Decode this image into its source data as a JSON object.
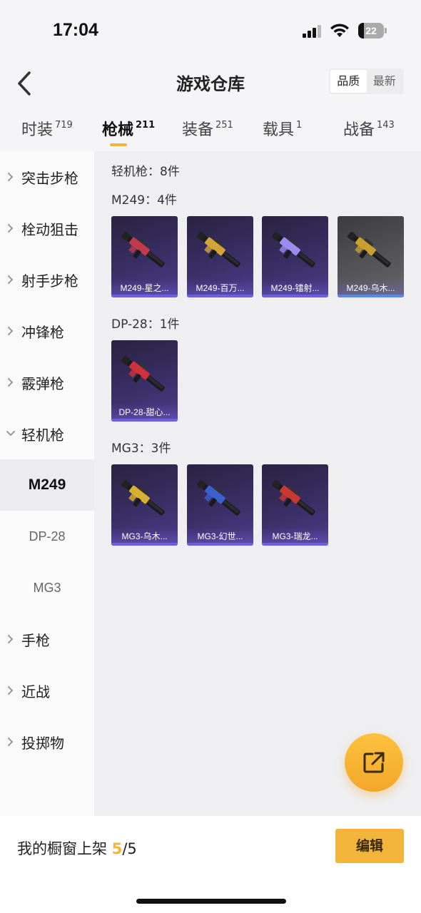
{
  "status": {
    "time": "17:04",
    "battery": "22"
  },
  "nav": {
    "title": "游戏仓库",
    "sort_options": [
      "品质",
      "最新"
    ],
    "sort_active": 0
  },
  "tabs": [
    {
      "label": "时装",
      "count": "719"
    },
    {
      "label": "枪械",
      "count": "211"
    },
    {
      "label": "装备",
      "count": "251"
    },
    {
      "label": "载具",
      "count": "1"
    },
    {
      "label": "战备",
      "count": "143"
    }
  ],
  "tab_active": 1,
  "sidebar": {
    "categories": [
      {
        "label": "突击步枪",
        "expanded": false
      },
      {
        "label": "栓动狙击",
        "expanded": false
      },
      {
        "label": "射手步枪",
        "expanded": false
      },
      {
        "label": "冲锋枪",
        "expanded": false
      },
      {
        "label": "霰弹枪",
        "expanded": false
      },
      {
        "label": "轻机枪",
        "expanded": true
      },
      {
        "label": "手枪",
        "expanded": false
      },
      {
        "label": "近战",
        "expanded": false
      },
      {
        "label": "投掷物",
        "expanded": false
      }
    ],
    "subitems": [
      {
        "label": "M249",
        "active": true
      },
      {
        "label": "DP-28",
        "active": false
      },
      {
        "label": "MG3",
        "active": false
      }
    ]
  },
  "content": {
    "summary": "轻机枪：8件",
    "groups": [
      {
        "title": "M249：4件",
        "items": [
          {
            "name": "M249-星之...",
            "style": "purple",
            "accent": "#c03a4a"
          },
          {
            "name": "M249-百万...",
            "style": "purple",
            "accent": "#d4a43a"
          },
          {
            "name": "M249-镭射...",
            "style": "purple",
            "accent": "#9a8cf0"
          },
          {
            "name": "M249-乌木...",
            "style": "gray",
            "accent": "#c8a030"
          }
        ]
      },
      {
        "title": "DP-28：1件",
        "items": [
          {
            "name": "DP-28-甜心...",
            "style": "purple",
            "accent": "#d0303c"
          }
        ]
      },
      {
        "title": "MG3：3件",
        "items": [
          {
            "name": "MG3-乌木...",
            "style": "purple",
            "accent": "#d8b030"
          },
          {
            "name": "MG3-幻世...",
            "style": "purple",
            "accent": "#3c60d0"
          },
          {
            "name": "MG3-瑞龙...",
            "style": "purple",
            "accent": "#c83a30"
          }
        ]
      }
    ]
  },
  "footer": {
    "showcase_label": "我的橱窗上架 ",
    "showcase_current": "5",
    "showcase_total": "/5",
    "edit_label": "编辑"
  },
  "colors": {
    "accent": "#f2b43b",
    "card_purple": "#3a2f66",
    "card_gray": "#56565a"
  }
}
